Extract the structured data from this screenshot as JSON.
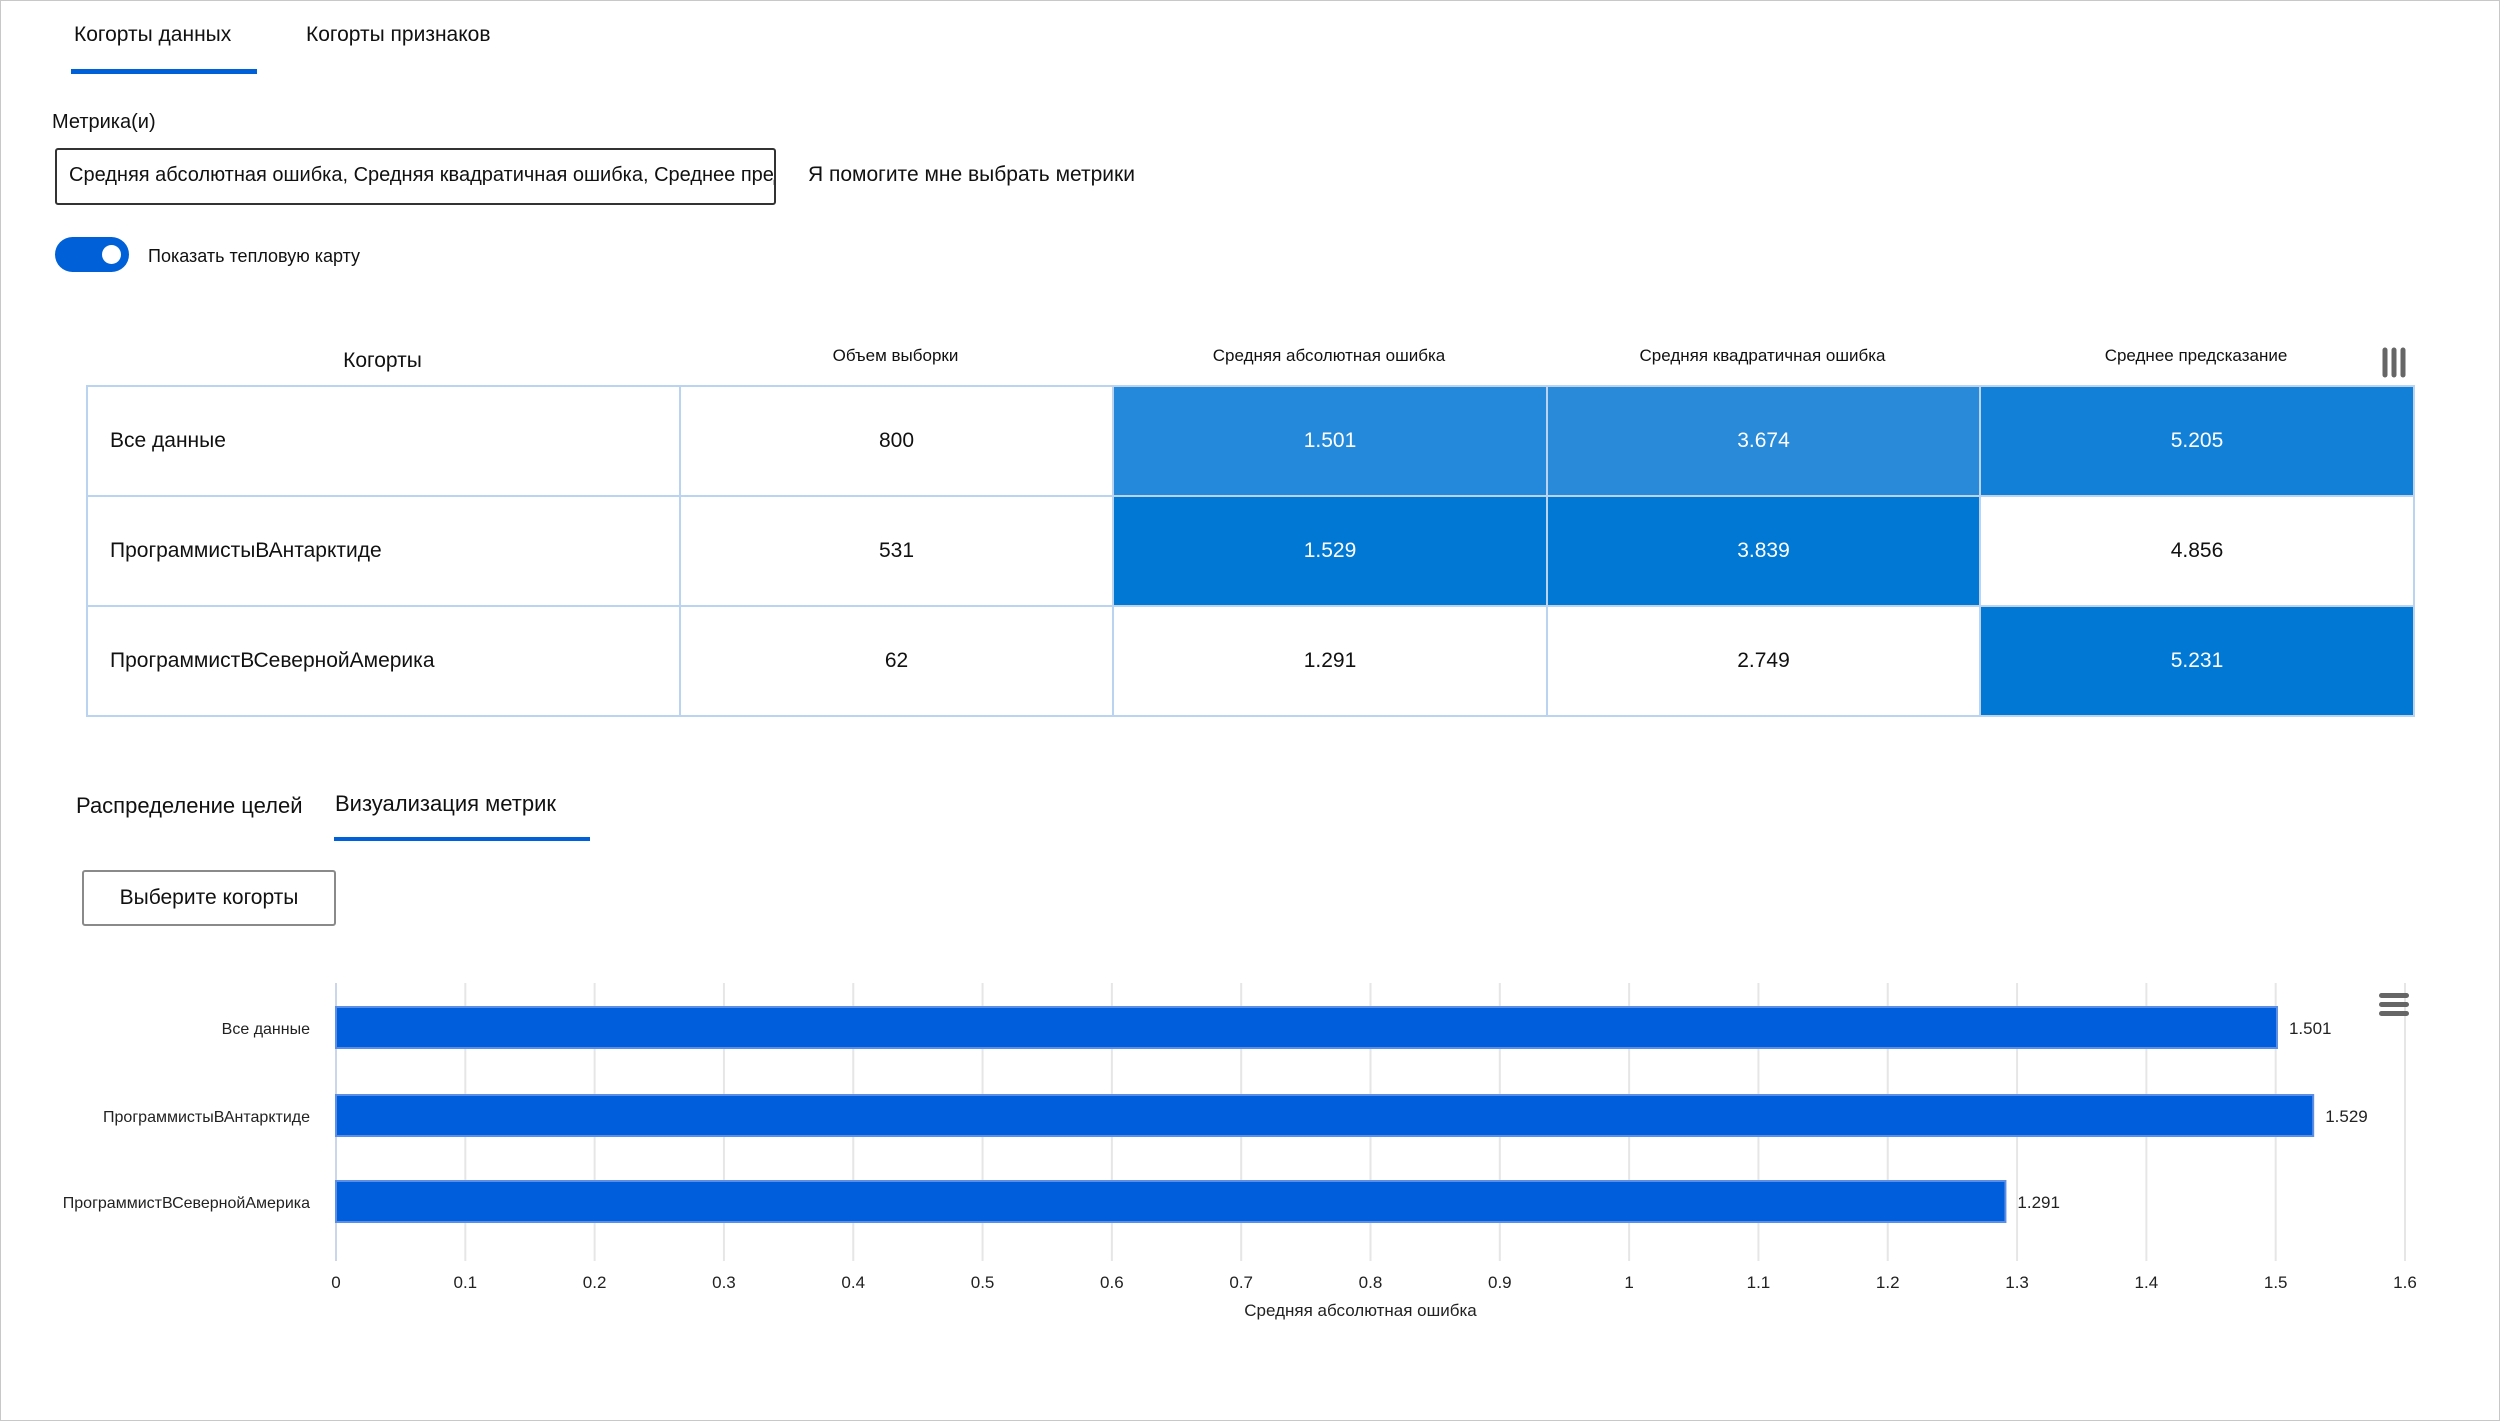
{
  "tabs": [
    {
      "label": "Когорты данных",
      "active": true
    },
    {
      "label": "Когорты признаков",
      "active": false
    }
  ],
  "metrics": {
    "label": "Метрика(и)",
    "value": "Средняя абсолютная ошибка, Средняя квадратичная ошибка, Среднее предсказание ... V",
    "help_link": "Я помогите мне выбрать метрики"
  },
  "heatmap_toggle": {
    "label": "Показать тепловую карту",
    "on": true
  },
  "table": {
    "headers": [
      "Когорты",
      "Объем выборки",
      "Средняя абсолютная ошибка",
      "Средняя квадратичная ошибка",
      "Среднее предсказание"
    ],
    "rows": [
      {
        "name": "Все данные",
        "cells": [
          "800",
          "1.501",
          "3.674",
          "5.205"
        ]
      },
      {
        "name": "ПрограммистыВАнтарктиде",
        "cells": [
          "531",
          "1.529",
          "3.839",
          "4.856"
        ]
      },
      {
        "name": "ПрограммистВСевернойАмерика",
        "cells": [
          "62",
          "1.291",
          "2.749",
          "5.231"
        ]
      }
    ],
    "heat_colors": [
      [
        "#ffffff",
        "#2589db",
        "#288ad9",
        "#1380d8"
      ],
      [
        "#ffffff",
        "#0078d4",
        "#0078d4",
        "#ffffff"
      ],
      [
        "#ffffff",
        "#ffffff",
        "#ffffff",
        "#0078d4"
      ]
    ],
    "menu_icon": "column-menu-icon"
  },
  "lower_tabs": [
    {
      "label": "Распределение целей",
      "active": false
    },
    {
      "label": "Визуализация метрик",
      "active": true
    }
  ],
  "select_cohorts_button": "Выберите когорты",
  "chart_data": {
    "type": "bar",
    "orientation": "horizontal",
    "categories": [
      "Все данные",
      "ПрограммистыВАнтарктиде",
      "ПрограммистВСевернойАмерика"
    ],
    "values": [
      1.501,
      1.529,
      1.291
    ],
    "data_labels": [
      "1.501",
      "1.529",
      "1.291"
    ],
    "xlabel": "Средняя абсолютная ошибка",
    "xlim": [
      0,
      1.6
    ],
    "xticks": [
      "0",
      "0.1",
      "0.2",
      "0.3",
      "0.4",
      "0.5",
      "0.6",
      "0.7",
      "0.8",
      "0.9",
      "1",
      "1.1",
      "1.2",
      "1.3",
      "1.4",
      "1.5",
      "1.6"
    ],
    "grid": true,
    "bar_color": "#005ddb"
  },
  "accent": "#0060d8"
}
